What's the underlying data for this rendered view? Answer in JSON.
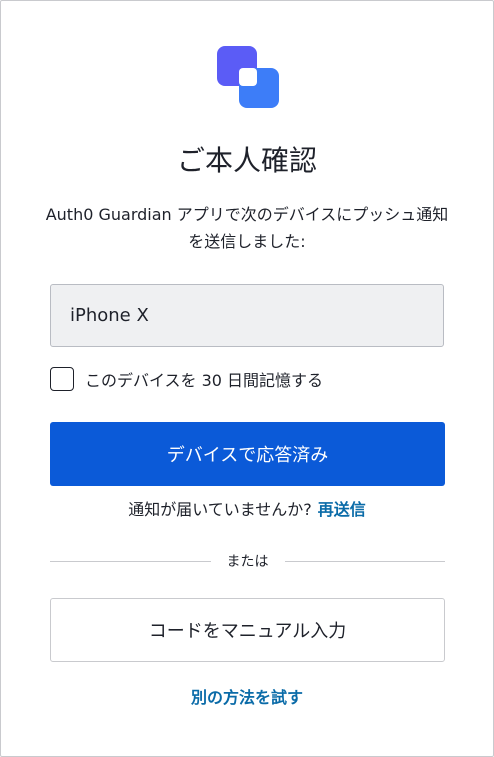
{
  "brand": {
    "logo_icon": "auth0-guardian-logo-icon",
    "accent_color": "#4f67f7",
    "accent_color_secondary": "#3d7df8"
  },
  "header": {
    "title": "ご本人確認",
    "description": "Auth0 Guardian アプリで次のデバイスにプッシュ通知を送信しました:"
  },
  "device": {
    "name": "iPhone X"
  },
  "remember": {
    "checked": false,
    "label": "このデバイスを 30 日間記憶する"
  },
  "actions": {
    "primary_label": "デバイスで応答済み",
    "primary_color": "#0b5ad8",
    "resend_prompt": "通知が届いていませんか?",
    "resend_link": "再送信",
    "link_color": "#0a6ba8",
    "divider_text": "または",
    "secondary_label": "コードをマニュアル入力",
    "alt_method_link": "別の方法を試す"
  }
}
